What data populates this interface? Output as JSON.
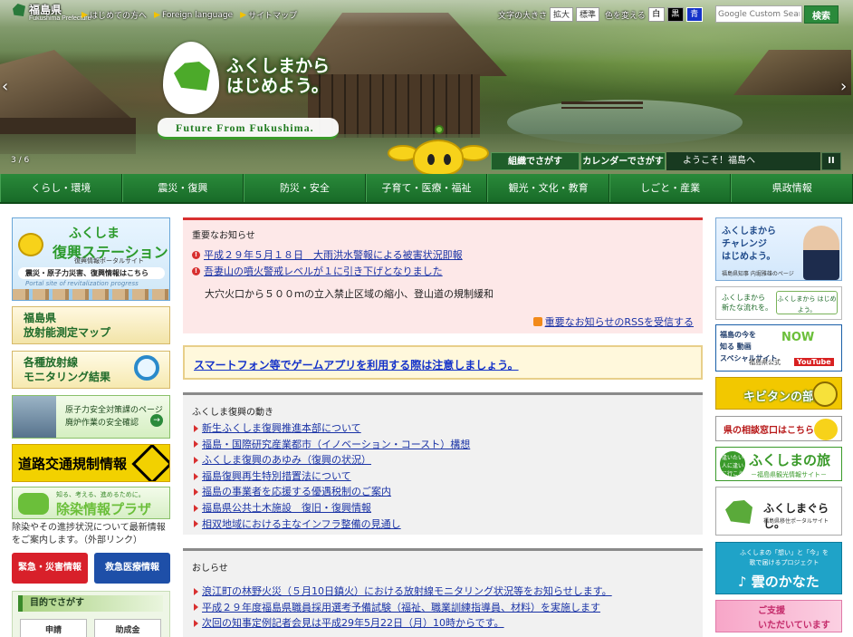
{
  "header": {
    "pref_name": "福島県",
    "pref_sub": "Fukushima Prefecture",
    "links": [
      "はじめての方へ",
      "Foreign language",
      "サイトマップ"
    ],
    "font_size_label": "文字の大きさ",
    "font_large": "拡大",
    "font_standard": "標準",
    "color_label": "色を変える",
    "color_white": "白",
    "color_black": "黒",
    "color_blue": "青",
    "search_placeholder": "Google Custom Search",
    "search_button": "検索"
  },
  "hero": {
    "slogan_line1": "ふくしまから",
    "slogan_line2": "はじめよう。",
    "tagline": "Future From Fukushima.",
    "slide_counter": "3 / 6",
    "arrow_left": "‹",
    "arrow_right": "›",
    "quick_org": "組織でさがす",
    "quick_calendar": "カレンダーでさがす",
    "news_ticker": "ようこそ！福島へ",
    "pause_label": "II"
  },
  "nav": [
    "くらし・環境",
    "震災・復興",
    "防災・安全",
    "子育て・医療・福祉",
    "観光・文化・教育",
    "しごと・産業",
    "県政情報"
  ],
  "left": {
    "fukko_t1": "ふくしま",
    "fukko_t2": "復興ステーション",
    "fukko_t3": "復興情報ポータルサイト",
    "fukko_t4": "震災・原子力災害、復興情報はこちら",
    "fukko_t5": "Portal site of revitalization progress",
    "hoshano_l1": "福島県",
    "hoshano_l2": "放射能測定マップ",
    "monitor_l1": "各種放射線",
    "monitor_l2": "モニタリング結果",
    "genshi_t1": "原子力安全対策課のページ",
    "genshi_t2": "廃炉作業の安全確認",
    "genshi_go": "→",
    "doro": "道路交通規制情報",
    "josen_t1": "知る、考える、進めるために。",
    "josen_t2": "除染情報プラザ",
    "josen_note": "除染やその進捗状況について最新情報をご案内します。（外部リンク）",
    "emergency": "緊急・災害情報",
    "medical": "救急医療情報",
    "purpose_title": "目的でさがす",
    "purpose_b1": "申請",
    "purpose_b2": "助成金"
  },
  "important": {
    "title": "重要なお知らせ",
    "items": [
      "平成２９年５月１８日　大雨洪水警報による被害状況即報",
      "吾妻山の噴火警戒レベルが１に引き下げとなりました"
    ],
    "note": "大穴火口から５００ｍの立入禁止区域の縮小、登山道の規制緩和",
    "rss": "重要なお知らせのRSSを受信する"
  },
  "warning_link": "スマートフォン等でゲームアプリを利用する際は注意しましょう。",
  "fukko_section": {
    "title": "ふくしま復興の動き",
    "items": [
      "新生ふくしま復興推進本部について",
      "福島・国際研究産業都市（イノベーション・コースト）構想",
      "ふくしま復興のあゆみ（復興の状況）",
      "福島復興再生特別措置法について",
      "福島の事業者を応援する優遇税制のご案内",
      "福島県公共土木施設　復旧・復興情報",
      "相双地域における主なインフラ整備の見通し"
    ]
  },
  "oshirase": {
    "title": "おしらせ",
    "items": [
      "浪江町の林野火災（５月10日鎮火）における放射線モニタリング状況等をお知らせします。",
      "平成２９年度福島県職員採用選考予備試験（福祉、職業訓練指導員、材料）を実施します",
      "次回の知事定例記者会見は平成29年5月22日（月）10時からです。"
    ]
  },
  "right": {
    "r1_l1": "ふくしまから",
    "r1_l2": "チャレンジ",
    "r1_l3": "はじめよう。",
    "r1_sub": "福島県知事 内堀雅雄のページ",
    "r2_l1": "ふくしまから",
    "r2_l2": "新たな流れを。",
    "r2_logo": "ふくしまから はじめよう。",
    "r3_l1": "福島の今を",
    "r3_l2": "知る 動画",
    "r3_l3": "スペシャルサイト",
    "r3_brand": "NOW",
    "r3_sub": "福島県公式",
    "r3_yt": "YouTube",
    "r4": "キビタンの部屋",
    "r5": "県の相談窓口はこちら",
    "r6_c": "逢いたい人に逢いに行こう",
    "r6_t": "ふくしまの旅",
    "r6_s": "－福島県観光情報サイト－",
    "r7_t": "ふくしまぐらし。",
    "r7_s": "福島県移住ポータルサイト",
    "r8_l1": "ふくしまの「想い」と「今」を",
    "r8_l2": "歌で届けるプロジェクト",
    "r8_n": "♪ 雲のかなた",
    "r9_l1": "ご支援",
    "r9_l2": "いただいています"
  }
}
